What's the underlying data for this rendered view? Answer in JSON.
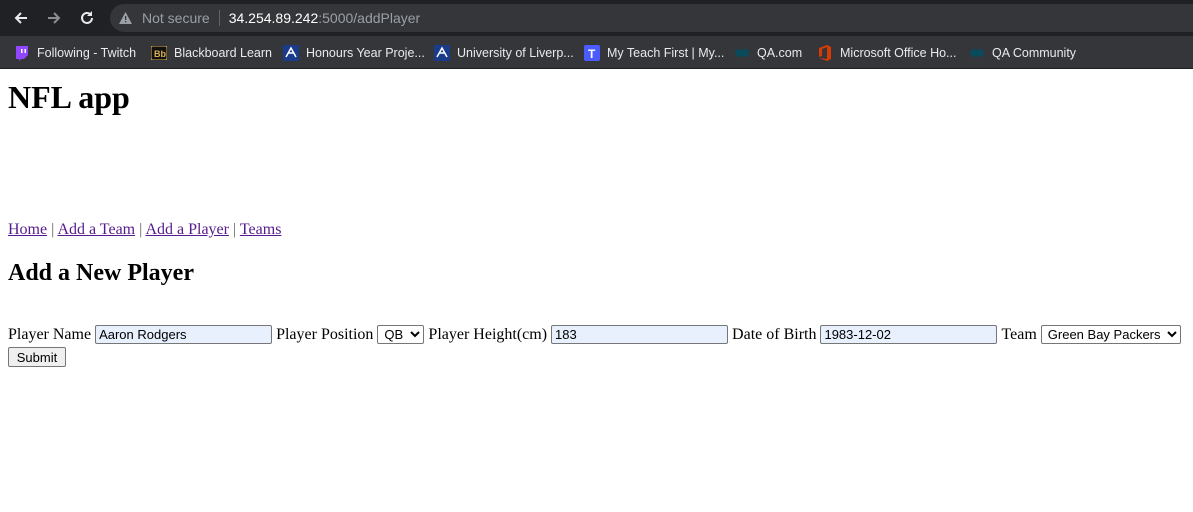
{
  "browser": {
    "security_label": "Not secure",
    "url_host": "34.254.89.242",
    "url_rest": ":5000/addPlayer",
    "bookmarks": [
      {
        "label": "Following - Twitch",
        "icon": "twitch-icon",
        "color": "#9146ff"
      },
      {
        "label": "Blackboard Learn",
        "icon": "blackboard-icon",
        "color": "#e0b050"
      },
      {
        "label": "Honours Year Proje...",
        "icon": "liverpool-icon",
        "color": "#1a3a8a"
      },
      {
        "label": "University of Liverp...",
        "icon": "liverpool-icon",
        "color": "#1a3a8a"
      },
      {
        "label": "My Teach First | My...",
        "icon": "teachfirst-icon",
        "color": "#4a5cff"
      },
      {
        "label": "QA.com",
        "icon": "qa-icon",
        "color": "#0b4a5a"
      },
      {
        "label": "Microsoft Office Ho...",
        "icon": "office-icon",
        "color": "#d83b01"
      },
      {
        "label": "QA Community",
        "icon": "qa-icon",
        "color": "#0b4a5a"
      }
    ]
  },
  "page": {
    "title": "NFL app",
    "nav": {
      "home": "Home",
      "add_team": "Add a Team",
      "add_player": "Add a Player",
      "teams": "Teams",
      "separator": "|"
    },
    "form_title": "Add a New Player",
    "form": {
      "player_name_label": "Player Name",
      "player_name_value": "Aaron Rodgers",
      "position_label": "Player Position",
      "position_value": "QB",
      "height_label": "Player Height(cm)",
      "height_value": "183",
      "dob_label": "Date of Birth",
      "dob_value": "1983-12-02",
      "team_label": "Team",
      "team_value": "Green Bay Packers",
      "submit_label": "Submit"
    }
  }
}
